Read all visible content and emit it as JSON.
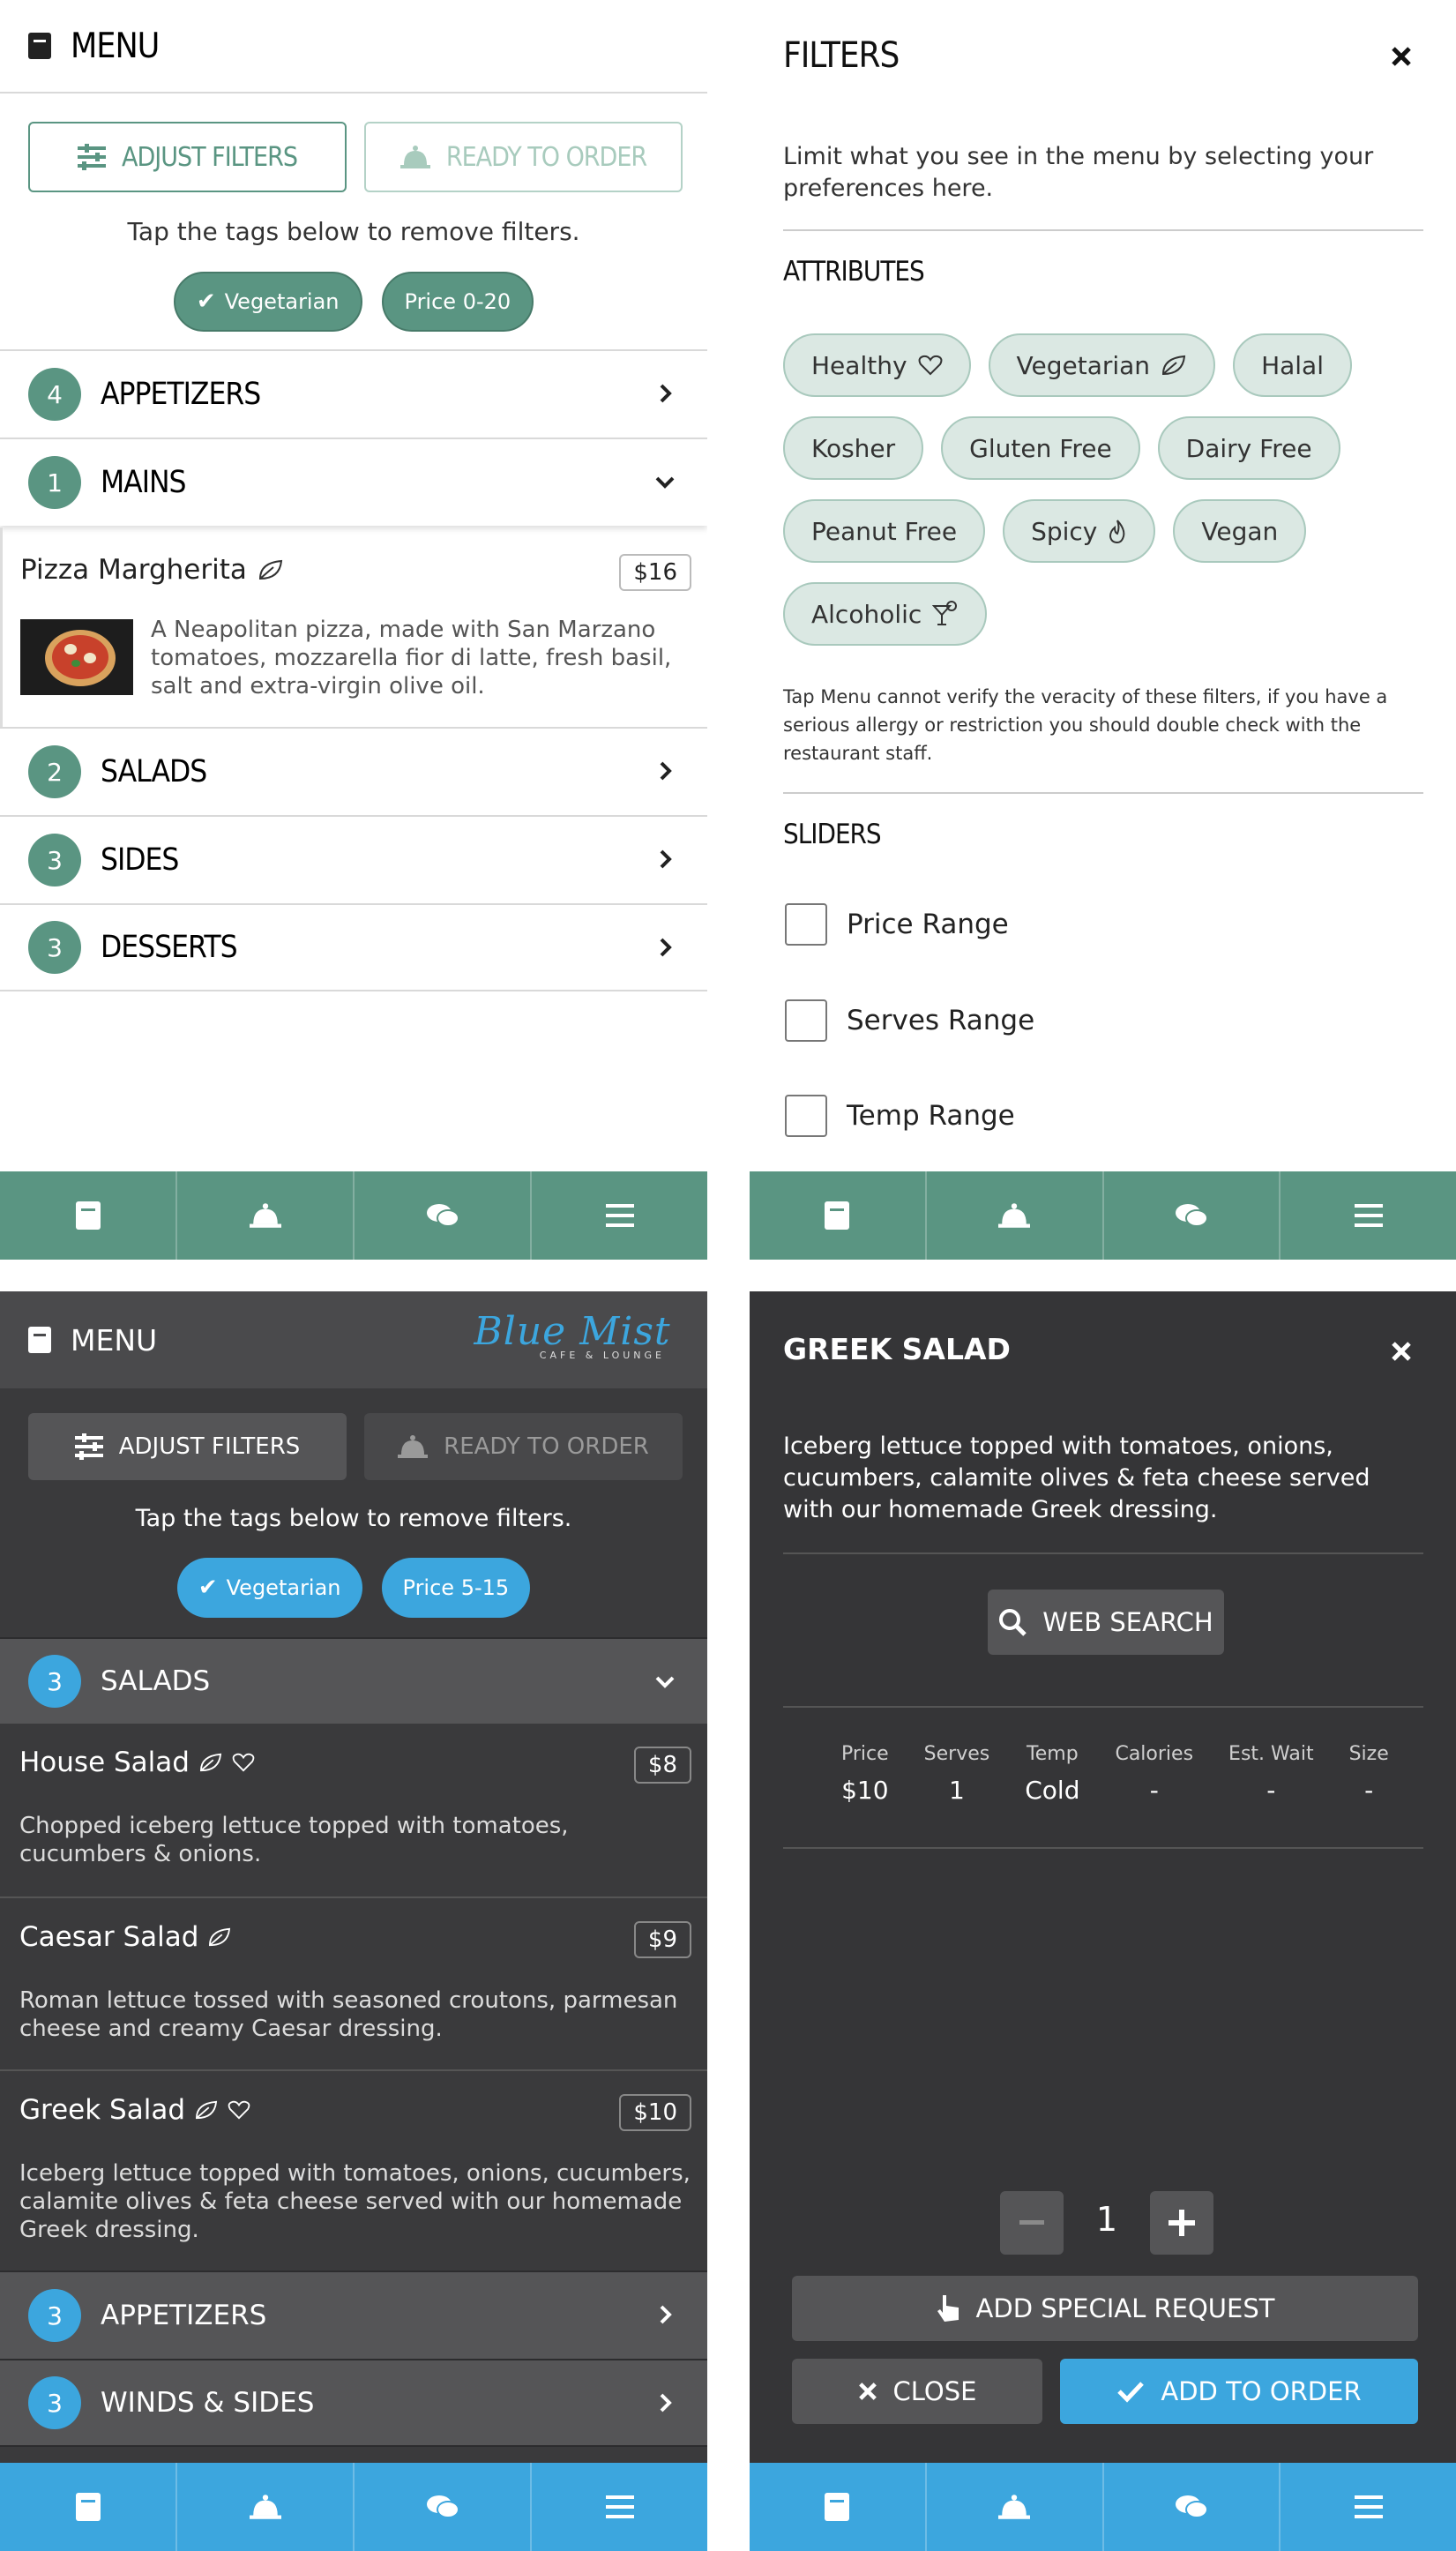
{
  "colors": {
    "green": "#5a9582",
    "blue": "#3ca6de",
    "dark": "#3a3a3c"
  },
  "p1": {
    "title": "MENU",
    "adjust": "ADJUST FILTERS",
    "ready": "READY TO ORDER",
    "hint": "Tap the tags below to remove filters.",
    "chips": [
      "Vegetarian",
      "Price 0-20"
    ],
    "cats": [
      {
        "n": "4",
        "label": "APPETIZERS"
      },
      {
        "n": "1",
        "label": "MAINS"
      },
      {
        "n": "2",
        "label": "SALADS"
      },
      {
        "n": "3",
        "label": "SIDES"
      },
      {
        "n": "3",
        "label": "DESSERTS"
      }
    ],
    "item": {
      "name": "Pizza Margherita",
      "price": "$16",
      "desc": "A Neapolitan pizza, made with San Marzano tomatoes, mozzarella fior di latte, fresh basil, salt and extra-virgin olive oil."
    }
  },
  "p2": {
    "title": "FILTERS",
    "intro": "Limit what you see in the menu by selecting your preferences here.",
    "attributes_h": "ATTRIBUTES",
    "attributes": [
      "Healthy",
      "Vegetarian",
      "Halal",
      "Kosher",
      "Gluten Free",
      "Dairy Free",
      "Peanut Free",
      "Spicy",
      "Vegan",
      "Alcoholic"
    ],
    "disclaimer": "Tap Menu cannot verify the veracity of these filters, if you have a serious allergy or restriction you should double check with the restaurant staff.",
    "sliders_h": "SLIDERS",
    "sliders": [
      "Price Range",
      "Serves Range",
      "Temp Range"
    ]
  },
  "p3": {
    "title": "MENU",
    "logo": "Blue Mist",
    "logo_sub": "CAFE & LOUNGE",
    "adjust": "ADJUST FILTERS",
    "ready": "READY TO ORDER",
    "hint": "Tap the tags below to remove filters.",
    "chips": [
      "Vegetarian",
      "Price 5-15"
    ],
    "open_cat": {
      "n": "3",
      "label": "SALADS"
    },
    "items": [
      {
        "name": "House Salad",
        "price": "$8",
        "desc": "Chopped iceberg lettuce topped with tomatoes, cucumbers & onions."
      },
      {
        "name": "Caesar Salad",
        "price": "$9",
        "desc": "Roman lettuce tossed with seasoned croutons, parmesan cheese and creamy Caesar dressing."
      },
      {
        "name": "Greek Salad",
        "price": "$10",
        "desc": "Iceberg lettuce topped with tomatoes, onions, cucumbers, calamite olives & feta cheese served with our homemade Greek dressing."
      }
    ],
    "cats": [
      {
        "n": "3",
        "label": "APPETIZERS"
      },
      {
        "n": "3",
        "label": "WINDS & SIDES"
      }
    ]
  },
  "p4": {
    "title": "GREEK SALAD",
    "desc": "Iceberg lettuce topped with tomatoes, onions, cucumbers, calamite olives & feta cheese served with our homemade Greek dressing.",
    "web_search": "WEB SEARCH",
    "facts": [
      {
        "h": "Price",
        "v": "$10"
      },
      {
        "h": "Serves",
        "v": "1"
      },
      {
        "h": "Temp",
        "v": "Cold"
      },
      {
        "h": "Calories",
        "v": "-"
      },
      {
        "h": "Est. Wait",
        "v": "-"
      },
      {
        "h": "Size",
        "v": "-"
      }
    ],
    "qty": "1",
    "special": "ADD SPECIAL REQUEST",
    "close": "CLOSE",
    "add": "ADD TO ORDER"
  }
}
